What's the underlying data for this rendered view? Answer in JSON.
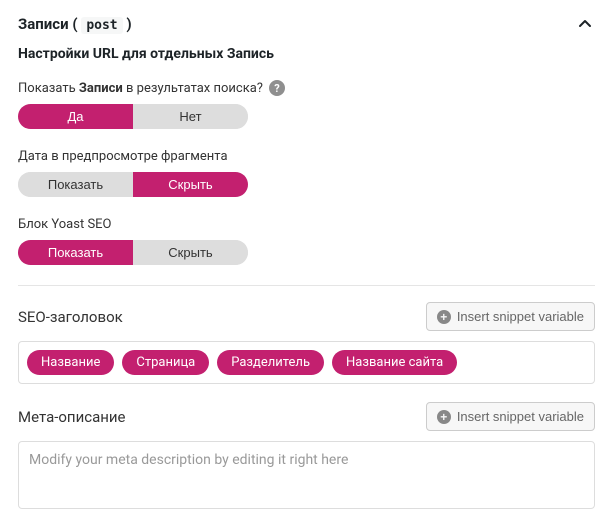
{
  "panel": {
    "title_word": "Записи",
    "title_paren_open": " ( ",
    "title_code": "post",
    "title_paren_close": " )"
  },
  "subtitle": "Настройки URL для отдельных Запись",
  "show_in_search": {
    "label_before": "Показать ",
    "label_bold": "Записи",
    "label_after": " в результатах поиска?",
    "yes": "Да",
    "no": "Нет"
  },
  "date_preview": {
    "label": "Дата в предпросмотре фрагмента",
    "show": "Показать",
    "hide": "Скрыть"
  },
  "yoast_block": {
    "label": "Блок Yoast SEO",
    "show": "Показать",
    "hide": "Скрыть"
  },
  "seo_title_section": {
    "label": "SEO-заголовок",
    "insert_btn": "Insert snippet variable",
    "chips": [
      "Название",
      "Страница",
      "Разделитель",
      "Название сайта"
    ]
  },
  "meta_desc_section": {
    "label": "Мета-описание",
    "insert_btn": "Insert snippet variable",
    "placeholder": "Modify your meta description by editing it right here"
  }
}
